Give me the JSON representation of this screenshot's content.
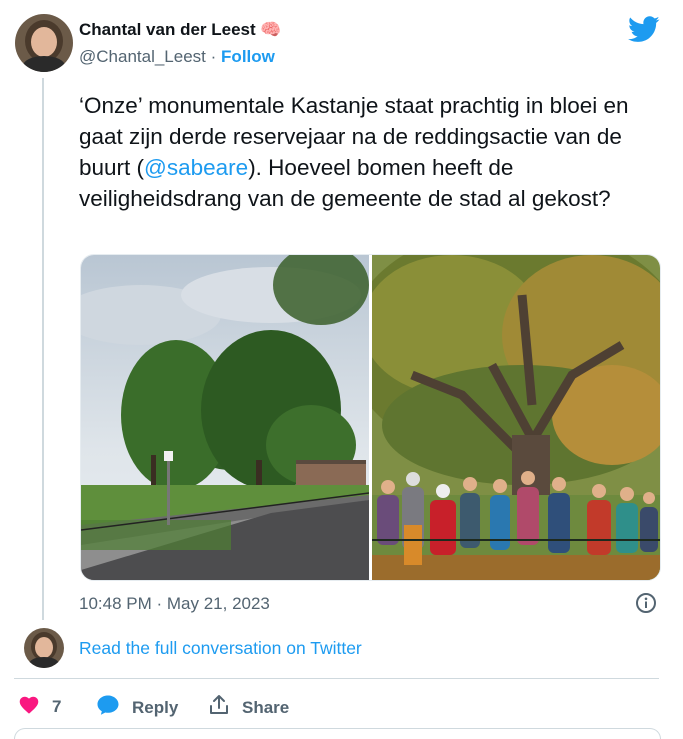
{
  "author": {
    "name": "Chantal van der Leest",
    "emoji": "🧠",
    "handle": "@Chantal_Leest",
    "separator": "·",
    "follow_label": "Follow"
  },
  "tweet": {
    "text_before": "‘Onze’ monumentale Kastanje staat prachtig in bloei en gaat zijn derde reservejaar na de reddingsactie van de buurt (",
    "mention": "@sabeare",
    "text_after": "). Hoeveel bomen heeft de veiligheidsdrang van de gemeente de stad al gekost?",
    "timestamp": "10:48 PM · May 21, 2023"
  },
  "conversation": {
    "read_label": "Read the full conversation on Twitter"
  },
  "actions": {
    "like_count": "7",
    "reply_label": "Reply",
    "share_label": "Share"
  },
  "colors": {
    "accent": "#1d9bf0",
    "like": "#f91880",
    "muted": "#536471"
  },
  "icons": [
    "twitter-bird-icon",
    "info-icon",
    "heart-icon",
    "reply-bubble-icon",
    "share-icon"
  ]
}
